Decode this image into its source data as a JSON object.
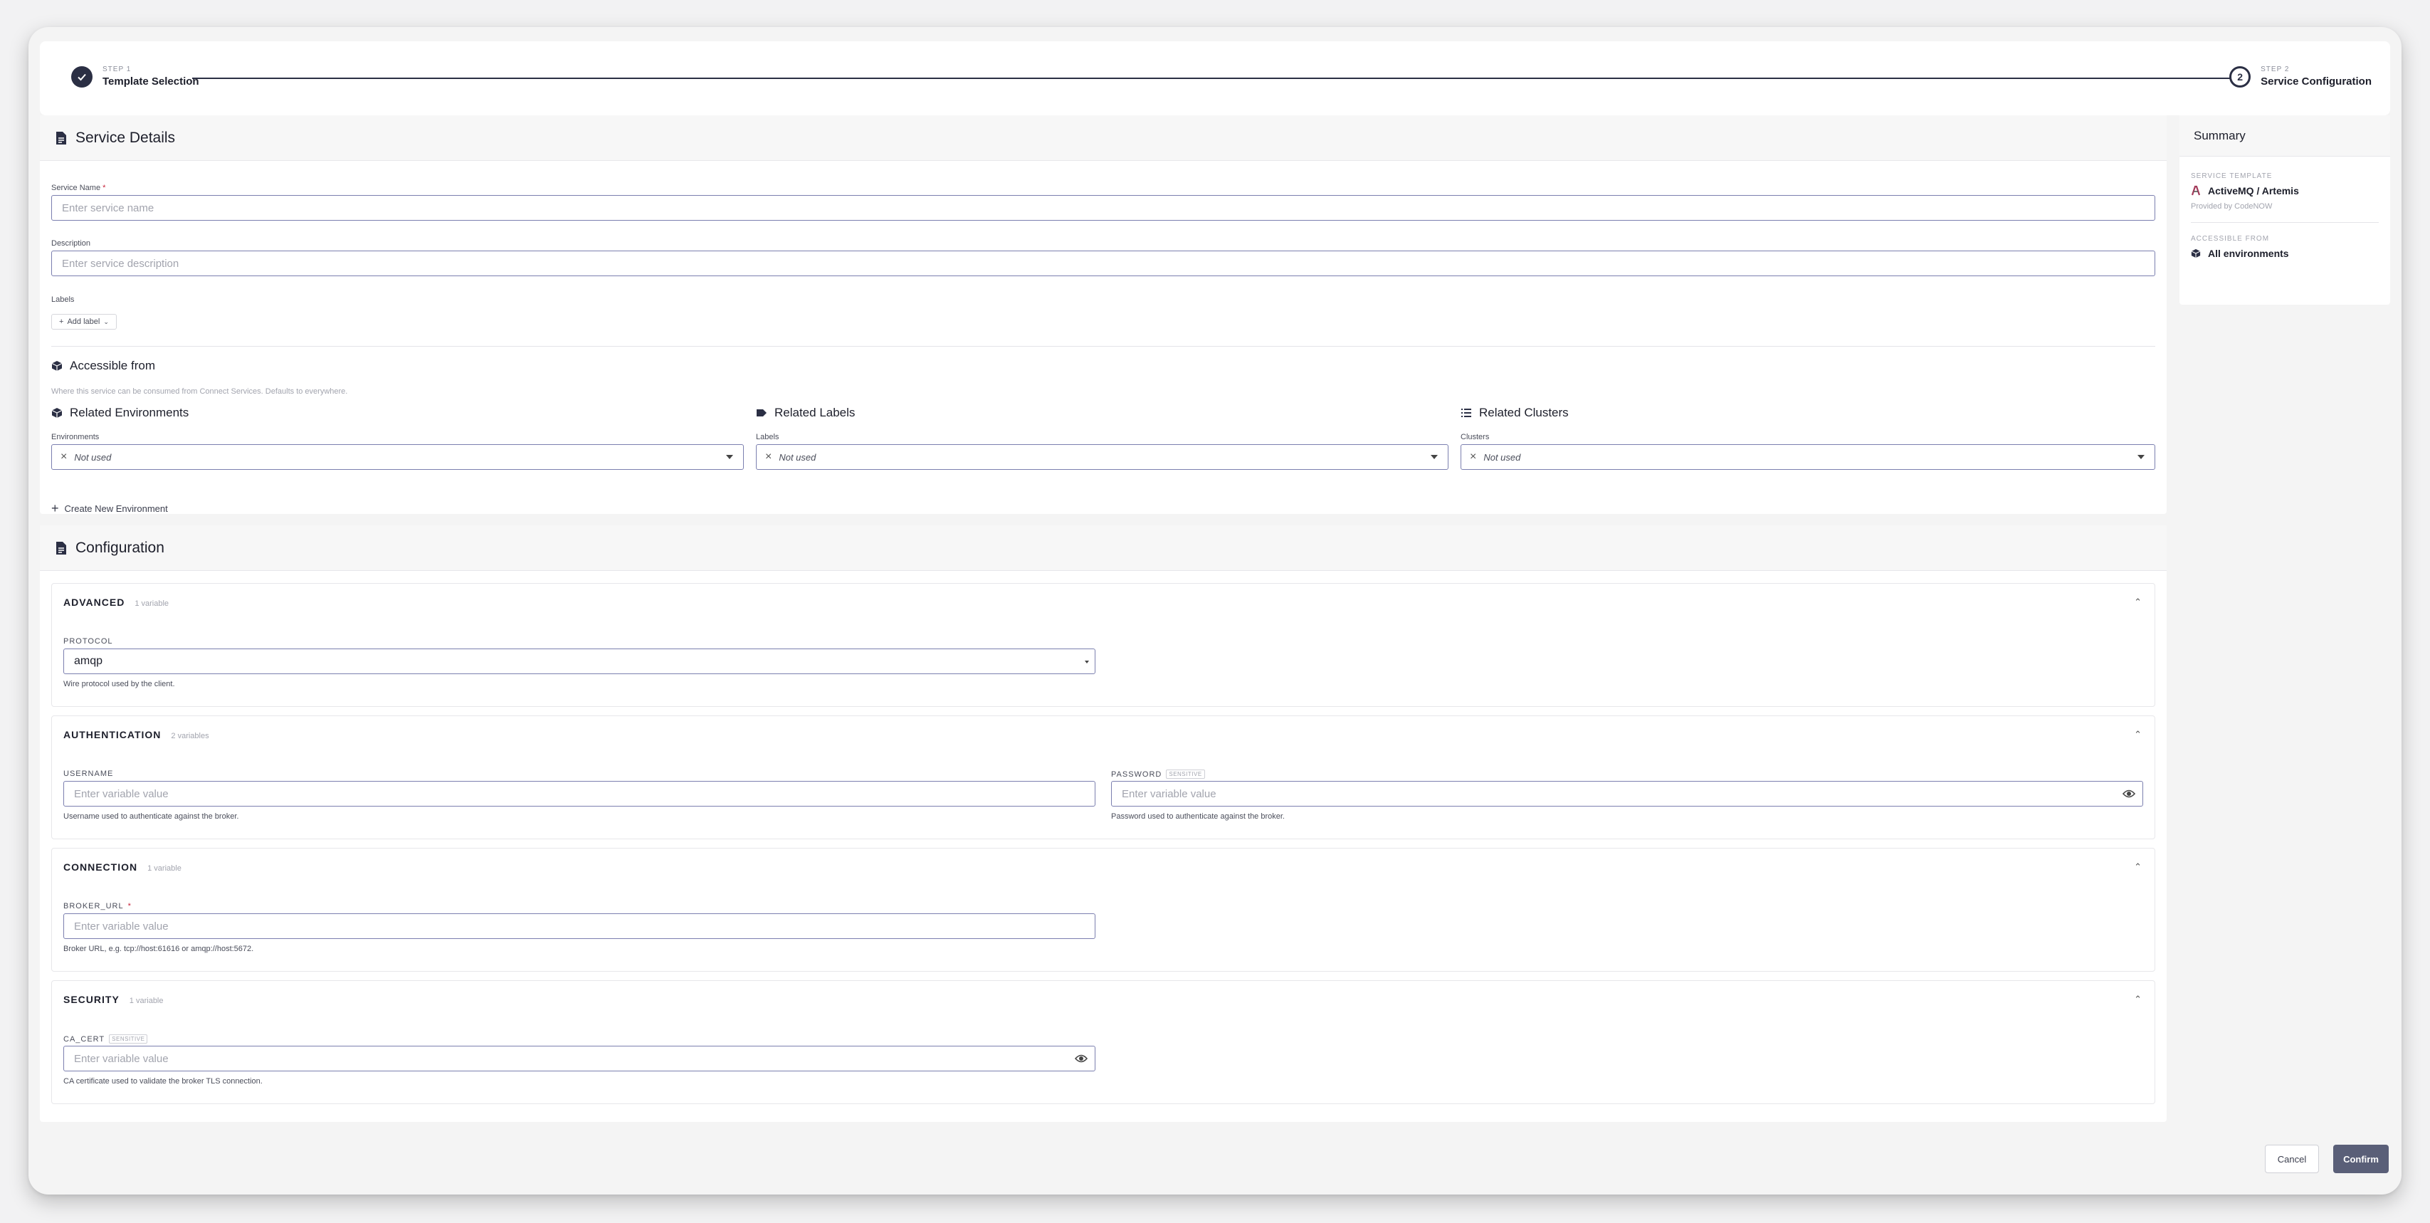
{
  "stepper": {
    "step1": {
      "eyebrow": "STEP 1",
      "title": "Template Selection"
    },
    "step2": {
      "eyebrow": "STEP 2",
      "title": "Service Configuration",
      "number": "2"
    }
  },
  "service_details": {
    "title": "Service Details",
    "name_label": "Service Name",
    "name_required_mark": "*",
    "name_placeholder": "Enter service name",
    "description_label": "Description",
    "description_placeholder": "Enter service description",
    "labels_label": "Labels",
    "add_label_button": "Add label",
    "accessible_from": {
      "title": "Accessible from",
      "hint": "Where this service can be consumed from Connect Services. Defaults to everywhere."
    },
    "related_environments": {
      "title": "Related Environments",
      "field_label": "Environments",
      "value": "Not used"
    },
    "related_labels": {
      "title": "Related Labels",
      "field_label": "Labels",
      "value": "Not used"
    },
    "related_clusters": {
      "title": "Related Clusters",
      "field_label": "Clusters",
      "value": "Not used"
    },
    "create_environment": "Create New Environment"
  },
  "configuration": {
    "title": "Configuration",
    "sections": [
      {
        "name": "ADVANCED",
        "count": "1 variable",
        "vars": [
          {
            "label": "PROTOCOL",
            "value": "amqp",
            "help": "Wire protocol used by the client."
          }
        ]
      },
      {
        "name": "AUTHENTICATION",
        "count": "2 variables",
        "vars": [
          {
            "label": "USERNAME",
            "placeholder": "Enter variable value",
            "help": "Username used to authenticate against the broker."
          },
          {
            "label": "PASSWORD",
            "badge": "SENSITIVE",
            "placeholder": "Enter variable value",
            "help": "Password used to authenticate against the broker."
          }
        ]
      },
      {
        "name": "CONNECTION",
        "count": "1 variable",
        "vars": [
          {
            "label": "BROKER_URL",
            "required_mark": "*",
            "placeholder": "Enter variable value",
            "help": "Broker URL, e.g. tcp://host:61616 or amqp://host:5672."
          }
        ]
      },
      {
        "name": "SECURITY",
        "count": "1 variable",
        "vars": [
          {
            "label": "CA_CERT",
            "badge": "SENSITIVE",
            "placeholder": "Enter variable value",
            "help": "CA certificate used to validate the broker TLS connection."
          }
        ]
      }
    ]
  },
  "summary": {
    "title": "Summary",
    "template_eyebrow": "SERVICE TEMPLATE",
    "template_name": "ActiveMQ / Artemis",
    "template_provider": "Provided by CodeNOW",
    "accessible_eyebrow": "ACCESSIBLE FROM",
    "accessible_value": "All environments"
  },
  "footer": {
    "cancel": "Cancel",
    "confirm": "Confirm"
  },
  "colors": {
    "accent": "#2b2f44",
    "input_border": "#7b7faf",
    "confirm_bg": "#5a5f78",
    "required": "#c7243a"
  }
}
